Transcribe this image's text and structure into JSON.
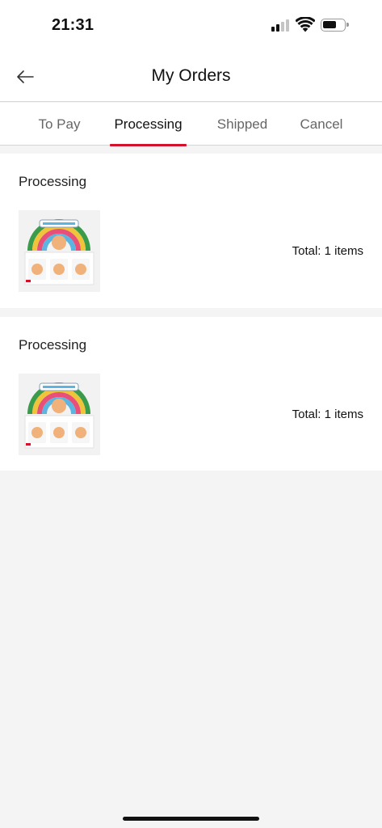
{
  "status_bar": {
    "time": "21:31",
    "icons": [
      "cellular-signal-icon",
      "wifi-icon",
      "battery-icon"
    ]
  },
  "header": {
    "back_icon": "arrow-left-icon",
    "title": "My Orders"
  },
  "tabs": [
    {
      "label": "To Pay",
      "active": false
    },
    {
      "label": "Processing",
      "active": true
    },
    {
      "label": "Shipped",
      "active": false
    },
    {
      "label": "Cancel",
      "active": false
    }
  ],
  "orders": [
    {
      "status": "Processing",
      "total": "Total: 1 items",
      "thumbnail": "product-box-image"
    },
    {
      "status": "Processing",
      "total": "Total: 1 items",
      "thumbnail": "product-box-image"
    }
  ],
  "colors": {
    "accent": "#d2112c",
    "page_background": "#f4f4f4",
    "card_background": "#ffffff",
    "inactive_tab": "#666666"
  }
}
